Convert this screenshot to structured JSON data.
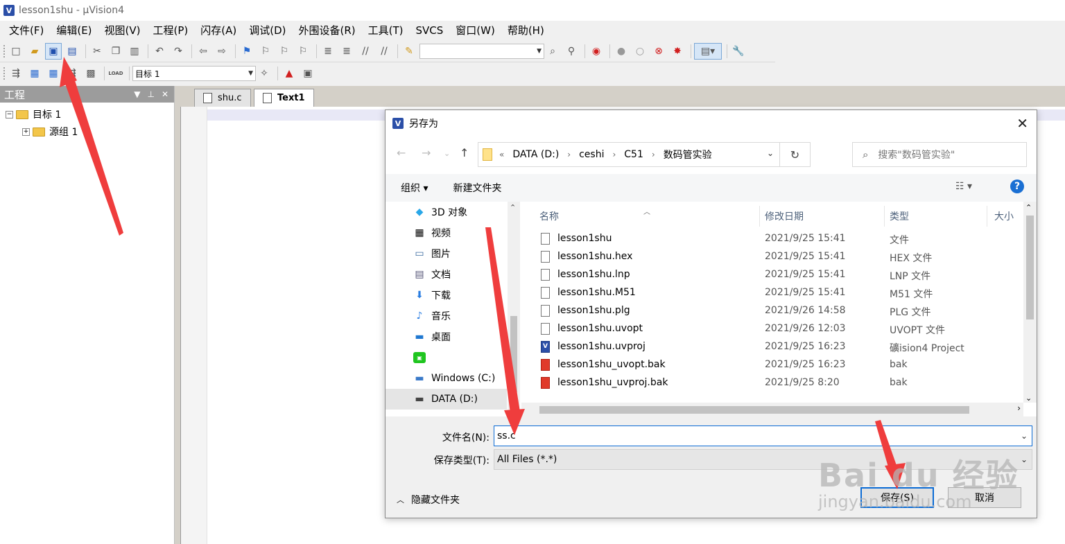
{
  "window": {
    "title": "lesson1shu  - µVision4",
    "icon_label": "V"
  },
  "menu": [
    "文件(F)",
    "编辑(E)",
    "视图(V)",
    "工程(P)",
    "闪存(A)",
    "调试(D)",
    "外围设备(R)",
    "工具(T)",
    "SVCS",
    "窗口(W)",
    "帮助(H)"
  ],
  "toolbar2": {
    "target_combo": "目标 1",
    "load_label": "LOAD"
  },
  "project_pane": {
    "title": "工程",
    "tree": [
      {
        "label": "目标 1",
        "expander": "−"
      },
      {
        "label": "源组 1",
        "expander": "+"
      }
    ]
  },
  "editor": {
    "tabs": [
      "shu.c",
      "Text1"
    ]
  },
  "dialog": {
    "title": "另存为",
    "breadcrumb": {
      "prefix": "«",
      "parts": [
        "DATA (D:)",
        "ceshi",
        "C51",
        "数码管实验"
      ]
    },
    "search_placeholder": "搜索\"数码管实验\"",
    "organize": "组织 ▾",
    "new_folder": "新建文件夹",
    "help": "?",
    "nav_items": [
      {
        "label": "3D 对象",
        "icon": "cube-icon"
      },
      {
        "label": "视频",
        "icon": "video-icon"
      },
      {
        "label": "图片",
        "icon": "picture-icon"
      },
      {
        "label": "文档",
        "icon": "document-icon"
      },
      {
        "label": "下载",
        "icon": "download-icon"
      },
      {
        "label": "音乐",
        "icon": "music-icon"
      },
      {
        "label": "桌面",
        "icon": "desktop-icon"
      },
      {
        "label": "",
        "icon": "iqiyi-icon"
      },
      {
        "label": "Windows (C:)",
        "icon": "drive-icon"
      },
      {
        "label": "DATA (D:)",
        "icon": "drive-icon",
        "selected": true
      }
    ],
    "columns": [
      "名称",
      "修改日期",
      "类型",
      "大小"
    ],
    "files": [
      {
        "name": "lesson1shu",
        "date": "2021/9/25 15:41",
        "type": "文件",
        "icon": "file-icon"
      },
      {
        "name": "lesson1shu.hex",
        "date": "2021/9/25 15:41",
        "type": "HEX 文件",
        "icon": "file-icon"
      },
      {
        "name": "lesson1shu.lnp",
        "date": "2021/9/25 15:41",
        "type": "LNP 文件",
        "icon": "file-icon"
      },
      {
        "name": "lesson1shu.M51",
        "date": "2021/9/25 15:41",
        "type": "M51 文件",
        "icon": "file-icon"
      },
      {
        "name": "lesson1shu.plg",
        "date": "2021/9/26 14:58",
        "type": "PLG 文件",
        "icon": "file-icon"
      },
      {
        "name": "lesson1shu.uvopt",
        "date": "2021/9/26 12:03",
        "type": "UVOPT 文件",
        "icon": "file-icon"
      },
      {
        "name": "lesson1shu.uvproj",
        "date": "2021/9/25 16:23",
        "type": "礦ision4 Project",
        "icon": "uvision-icon"
      },
      {
        "name": "lesson1shu_uvopt.bak",
        "date": "2021/9/25 16:23",
        "type": "bak",
        "icon": "bak-icon"
      },
      {
        "name": "lesson1shu_uvproj.bak",
        "date": "2021/9/25 8:20",
        "type": "bak",
        "icon": "bak-icon"
      }
    ],
    "filename_label": "文件名(N):",
    "filename_value": "ss.c",
    "filetype_label": "保存类型(T):",
    "filetype_value": "All Files (*.*)",
    "hide_folders": "隐藏文件夹",
    "save": "保存(S)",
    "cancel": "取消"
  },
  "watermark": {
    "logo": "Bai du 经验",
    "url": "jingyan.baidu.com"
  },
  "colors": {
    "accent": "#0a6ad4",
    "arrow": "#ef3d3d",
    "tree_header": "#9c9c9c"
  }
}
